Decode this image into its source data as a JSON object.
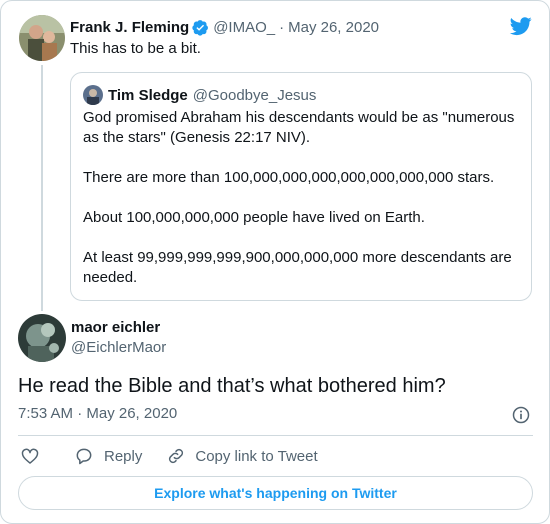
{
  "tweet": {
    "name": "Frank J. Fleming",
    "handle": "@IMAO_",
    "separator": "·",
    "date": "May 26, 2020",
    "text": "This has to be a bit."
  },
  "quoted": {
    "name": "Tim Sledge",
    "handle": "@Goodbye_Jesus",
    "paragraphs": [
      "God promised Abraham his descendants would be as \"numerous as the stars\" (Genesis 22:17 NIV).",
      "There are more than 100,000,000,000,000,000,000,000 stars.",
      "About 100,000,000,000 people have lived on Earth.",
      "At least 99,999,999,999,900,000,000,000 more descendants are needed."
    ]
  },
  "reply": {
    "name": "maor eichler",
    "handle": "@EichlerMaor",
    "text": "He read the Bible and that’s what bothered him?",
    "timestamp": "7:53 AM · May 26, 2020"
  },
  "actions": {
    "reply_label": "Reply",
    "copy_label": "Copy link to Tweet"
  },
  "explore_label": "Explore what's happening on Twitter",
  "colors": {
    "accent": "#1d9bf0",
    "text": "#0f1419",
    "muted": "#536471",
    "border": "#cfd9de"
  }
}
